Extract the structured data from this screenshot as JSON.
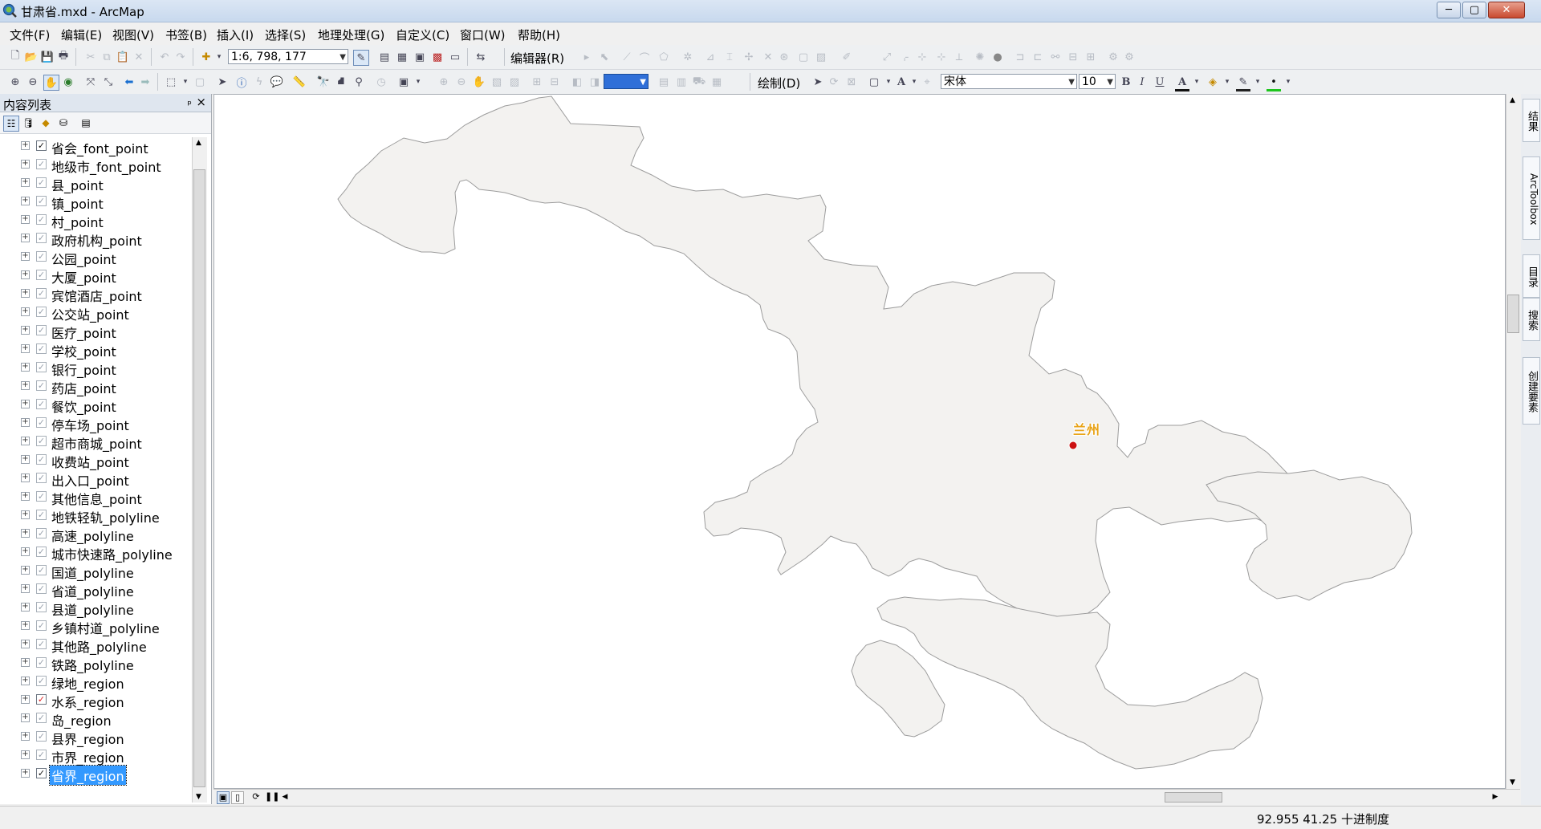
{
  "window": {
    "title": "甘肃省.mxd - ArcMap",
    "minimize": "─",
    "maximize": "▢",
    "close": "✕"
  },
  "menu": [
    "文件(F)",
    "编辑(E)",
    "视图(V)",
    "书签(B)",
    "插入(I)",
    "选择(S)",
    "地理处理(G)",
    "自定义(C)",
    "窗口(W)",
    "帮助(H)"
  ],
  "toolbar1": {
    "scale": "1:6, 798, 177",
    "editor": "编辑器(R)"
  },
  "toolbar2": {
    "draw": "绘制(D)",
    "font": "宋体",
    "font_size": "10",
    "bold": "B",
    "italic": "I",
    "underline": "U",
    "text_a": "A"
  },
  "toc": {
    "title": "内容列表",
    "pin": "ₚ",
    "close": "×",
    "layers": [
      {
        "name": "省会_font_point",
        "checked": true,
        "style": "dark"
      },
      {
        "name": "地级市_font_point",
        "checked": true,
        "style": "light"
      },
      {
        "name": "县_point",
        "checked": true,
        "style": "light"
      },
      {
        "name": "镇_point",
        "checked": true,
        "style": "light"
      },
      {
        "name": "村_point",
        "checked": true,
        "style": "light"
      },
      {
        "name": "政府机构_point",
        "checked": true,
        "style": "light"
      },
      {
        "name": "公园_point",
        "checked": true,
        "style": "light"
      },
      {
        "name": "大厦_point",
        "checked": true,
        "style": "light"
      },
      {
        "name": "宾馆酒店_point",
        "checked": true,
        "style": "light"
      },
      {
        "name": "公交站_point",
        "checked": true,
        "style": "light"
      },
      {
        "name": "医疗_point",
        "checked": true,
        "style": "light"
      },
      {
        "name": "学校_point",
        "checked": true,
        "style": "light"
      },
      {
        "name": "银行_point",
        "checked": true,
        "style": "light"
      },
      {
        "name": "药店_point",
        "checked": true,
        "style": "light"
      },
      {
        "name": "餐饮_point",
        "checked": true,
        "style": "light"
      },
      {
        "name": "停车场_point",
        "checked": true,
        "style": "light"
      },
      {
        "name": "超市商城_point",
        "checked": true,
        "style": "light"
      },
      {
        "name": "收费站_point",
        "checked": true,
        "style": "light"
      },
      {
        "name": "出入口_point",
        "checked": true,
        "style": "light"
      },
      {
        "name": "其他信息_point",
        "checked": true,
        "style": "light"
      },
      {
        "name": "地铁轻轨_polyline",
        "checked": true,
        "style": "light"
      },
      {
        "name": "高速_polyline",
        "checked": true,
        "style": "light"
      },
      {
        "name": "城市快速路_polyline",
        "checked": true,
        "style": "light"
      },
      {
        "name": "国道_polyline",
        "checked": true,
        "style": "light"
      },
      {
        "name": "省道_polyline",
        "checked": true,
        "style": "light"
      },
      {
        "name": "县道_polyline",
        "checked": true,
        "style": "light"
      },
      {
        "name": "乡镇村道_polyline",
        "checked": true,
        "style": "light"
      },
      {
        "name": "其他路_polyline",
        "checked": true,
        "style": "light"
      },
      {
        "name": "铁路_polyline",
        "checked": true,
        "style": "light"
      },
      {
        "name": "绿地_region",
        "checked": true,
        "style": "light"
      },
      {
        "name": "水系_region",
        "checked": true,
        "style": "red"
      },
      {
        "name": "岛_region",
        "checked": true,
        "style": "light"
      },
      {
        "name": "县界_region",
        "checked": true,
        "style": "light"
      },
      {
        "name": "市界_region",
        "checked": true,
        "style": "light"
      },
      {
        "name": "省界_region",
        "checked": true,
        "style": "dark",
        "selected": true
      }
    ]
  },
  "map": {
    "city_label": "兰州",
    "region_fill": "#f3f2f0",
    "region_stroke": "#9c9c9c",
    "point_color": "#cc1111",
    "label_color": "#e8a317"
  },
  "right_dock": [
    "结果",
    "ArcToolbox",
    "目录",
    "搜索",
    "创建要素"
  ],
  "status": {
    "coordinates": "92.955  41.25 十进制度"
  }
}
